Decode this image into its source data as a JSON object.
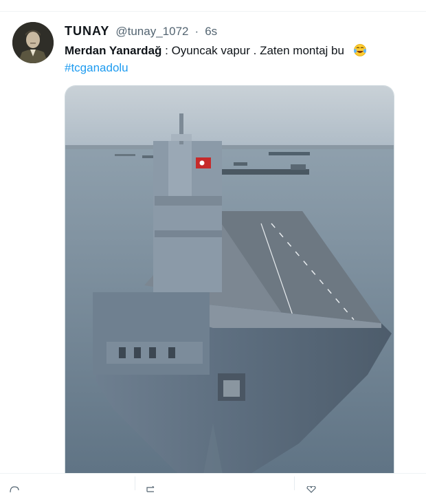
{
  "tweet": {
    "display_name": "TUNAY",
    "handle": "@tunay_1072",
    "separator": "·",
    "time": "6s",
    "quote_author": "Merdan Yanardağ",
    "quote_text": ": Oyuncak vapur . Zaten montaj bu",
    "emoji_icon": "face-with-tears-of-joy-icon",
    "hashtag": "#tcganadolu"
  },
  "colors": {
    "link": "#1d9bf0",
    "secondary_text": "#536471",
    "sea": "#6f8496",
    "hull": "#5d6e80"
  }
}
